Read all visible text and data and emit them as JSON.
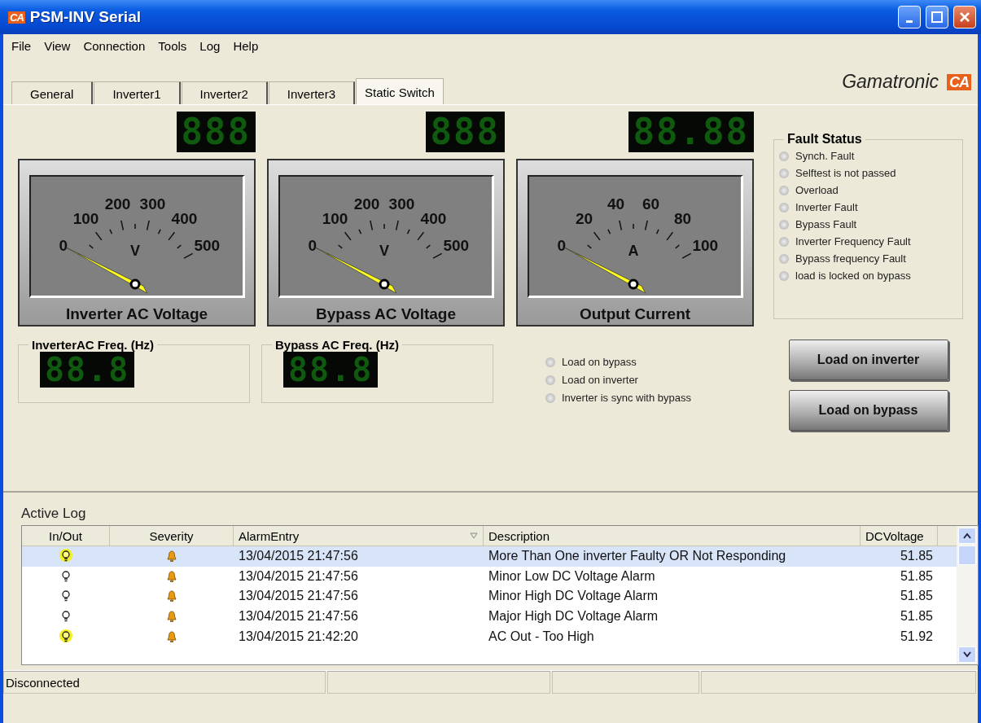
{
  "window": {
    "icon": "CA",
    "title": "PSM-INV Serial"
  },
  "menu": [
    "File",
    "View",
    "Connection",
    "Tools",
    "Log",
    "Help"
  ],
  "logo": {
    "name": "Gamatronic",
    "mark": "CA"
  },
  "tabs": [
    {
      "label": "General",
      "selected": false
    },
    {
      "label": "Inverter1",
      "selected": false
    },
    {
      "label": "Inverter2",
      "selected": false
    },
    {
      "label": "Inverter3",
      "selected": false
    },
    {
      "label": "Static Switch",
      "selected": true
    }
  ],
  "gauges": [
    {
      "readout": "888",
      "title": "Inverter AC Voltage",
      "unit": "V",
      "scale": [
        "0",
        "100",
        "200",
        "300",
        "400",
        "500"
      ]
    },
    {
      "readout": "888",
      "title": "Bypass AC Voltage",
      "unit": "V",
      "scale": [
        "0",
        "100",
        "200",
        "300",
        "400",
        "500"
      ]
    },
    {
      "readout": "88.88",
      "title": "Output Current",
      "unit": "A",
      "scale": [
        "0",
        "20",
        "40",
        "60",
        "80",
        "100"
      ]
    }
  ],
  "fault_status": {
    "title": "Fault Status",
    "items": [
      {
        "label": "Synch. Fault",
        "on": false
      },
      {
        "label": "Selftest is not passed",
        "on": false
      },
      {
        "label": "Overload",
        "on": false
      },
      {
        "label": "Inverter Fault",
        "on": false
      },
      {
        "label": "Bypass Fault",
        "on": false
      },
      {
        "label": "Inverter Frequency Fault",
        "on": false
      },
      {
        "label": "Bypass frequency Fault",
        "on": false
      },
      {
        "label": "load is locked on bypass",
        "on": false
      }
    ]
  },
  "frequencies": [
    {
      "title": "InverterAC Freq. (Hz)",
      "readout": "88.8"
    },
    {
      "title": "Bypass AC Freq. (Hz)",
      "readout": "88.8"
    }
  ],
  "indicators": [
    {
      "label": "Load on bypass",
      "on": false
    },
    {
      "label": "Load on inverter",
      "on": false
    },
    {
      "label": "Inverter is sync with bypass",
      "on": false
    }
  ],
  "buttons": [
    "Load on inverter",
    "Load on bypass"
  ],
  "active_log": {
    "title": "Active Log",
    "columns": [
      {
        "label": "In/Out",
        "sorted": false
      },
      {
        "label": "Severity",
        "sorted": false
      },
      {
        "label": "AlarmEntry",
        "sorted": true
      },
      {
        "label": "Description",
        "sorted": false
      },
      {
        "label": "DCVoltage",
        "sorted": false
      }
    ],
    "rows": [
      {
        "lit": true,
        "selected": true,
        "alarm_entry": "13/04/2015 21:47:56",
        "description": "More Than One inverter Faulty OR Not Responding",
        "dc_voltage": "51.85"
      },
      {
        "lit": false,
        "selected": false,
        "alarm_entry": "13/04/2015 21:47:56",
        "description": "Minor Low DC Voltage Alarm",
        "dc_voltage": "51.85"
      },
      {
        "lit": false,
        "selected": false,
        "alarm_entry": "13/04/2015 21:47:56",
        "description": "Minor High DC Voltage Alarm",
        "dc_voltage": "51.85"
      },
      {
        "lit": false,
        "selected": false,
        "alarm_entry": "13/04/2015 21:47:56",
        "description": "Major High DC Voltage Alarm",
        "dc_voltage": "51.85"
      },
      {
        "lit": true,
        "selected": false,
        "alarm_entry": "13/04/2015 21:42:20",
        "description": "AC Out - Too High",
        "dc_voltage": "51.92"
      }
    ]
  },
  "status_bar": [
    "Disconnected"
  ]
}
